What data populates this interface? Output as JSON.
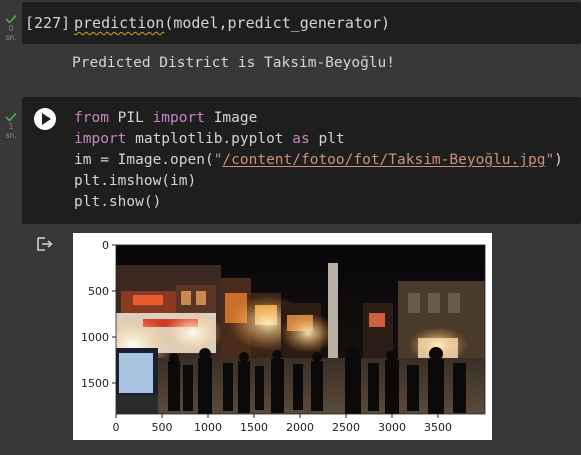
{
  "cell1": {
    "status_icon": "check-icon",
    "gutter_number": "0",
    "gutter_unit": "sn.",
    "execution_count": "[227]",
    "code": {
      "call": "prediction",
      "args": "(model,predict_generator)"
    },
    "output": "Predicted District is Taksim-Beyoğlu!"
  },
  "cell2": {
    "status_icon": "check-icon",
    "gutter_number": "1",
    "gutter_unit": "sn.",
    "run_icon": "play-icon",
    "code": {
      "line1_kw1": "from",
      "line1_mod": " PIL ",
      "line1_kw2": "import",
      "line1_rest": " Image",
      "line2_kw1": "import",
      "line2_mod": " matplotlib.pyplot ",
      "line2_kw2": "as",
      "line2_rest": " plt",
      "line3_pre": "im = Image.open(",
      "line3_q1": "\"",
      "line3_path": "/content/fotoo/fot/Taksim-Beyoğlu.jpg",
      "line3_q2": "\"",
      "line3_post": ")",
      "line4": "plt.imshow(im)",
      "line5": "plt.show()"
    },
    "output_icon": "output-arrow-icon",
    "figure": {
      "type": "image",
      "description_icon": "photo",
      "y_ticks": [
        "0",
        "500",
        "1000",
        "1500"
      ],
      "x_ticks": [
        "0",
        "500",
        "1000",
        "1500",
        "2000",
        "2500",
        "3000",
        "3500"
      ]
    }
  },
  "colors": {
    "background": "#383838",
    "cell_bg": "#1e1e1e",
    "keyword": "#c586c0",
    "string": "#ce9178",
    "check": "#4caf50"
  }
}
